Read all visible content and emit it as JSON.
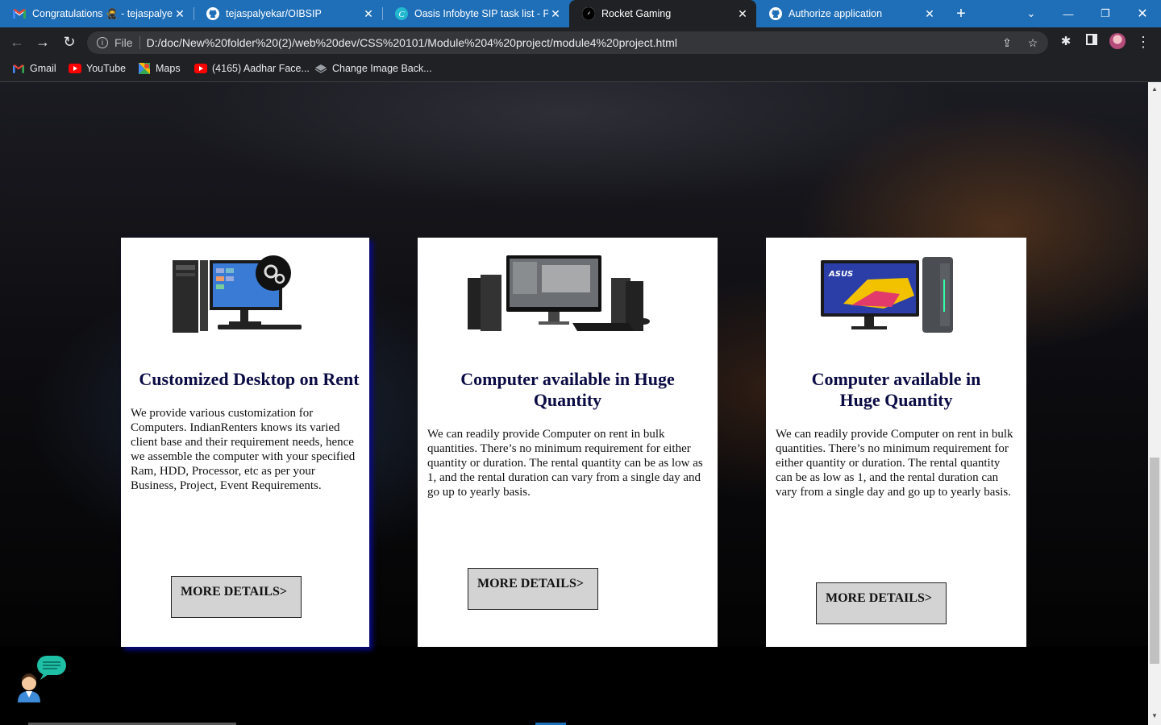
{
  "browser": {
    "tabs": [
      {
        "title": "Congratulations 🥷 - tejaspalyekar",
        "icon": "gmail-icon"
      },
      {
        "title": "tejaspalyekar/OIBSIP",
        "icon": "github-icon"
      },
      {
        "title": "Oasis Infobyte SIP task list - Pre",
        "icon": "canva-icon"
      },
      {
        "title": "Rocket Gaming",
        "icon": "rocket-icon"
      },
      {
        "title": "Authorize application",
        "icon": "github-icon"
      }
    ],
    "active_tab": 3,
    "address_scheme": "File",
    "url": "D:/doc/New%20folder%20(2)/web%20dev/CSS%20101/Module%204%20project/module4%20project.html",
    "bookmarks": [
      {
        "label": "Gmail",
        "icon": "gmail-icon"
      },
      {
        "label": "YouTube",
        "icon": "youtube-icon"
      },
      {
        "label": "Maps",
        "icon": "maps-icon"
      },
      {
        "label": "(4165) Aadhar Face...",
        "icon": "youtube-icon"
      },
      {
        "label": "Change Image Back...",
        "icon": "layers-icon"
      }
    ]
  },
  "cards": [
    {
      "title": "Customized Desktop on Rent",
      "text": "We provide various customization for Computers. IndianRenters knows its varied client base and their requirement needs, hence we assemble the computer with your specified Ram, HDD, Processor, etc as per your Business, Project, Event Requirements.",
      "button": "MORE DETAILS>"
    },
    {
      "title": "Computer available in Huge Quantity",
      "text": "We can readily provide Computer on rent in bulk quantities. There’s no minimum requirement for either quantity or duration. The rental quantity can be as low as 1, and the rental duration can vary from a single day and go up to yearly basis.",
      "button": "MORE DETAILS>"
    },
    {
      "title": "Computer available in Huge Quantity",
      "text": "We can readily provide Computer on rent in bulk quantities. There’s no minimum requirement for either quantity or duration. The rental quantity can be as low as 1, and the rental duration can vary from a single day and go up to yearly basis.",
      "button": "MORE DETAILS>"
    }
  ],
  "colors": {
    "tab_strip": "#1f6fb8",
    "heading": "#0b0b45",
    "button_bg": "#d3d3d3",
    "card_shadow": "#0a0a8a"
  }
}
